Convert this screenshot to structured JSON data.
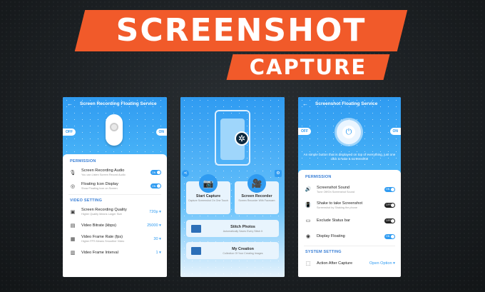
{
  "banner": {
    "line1": "SCREENSHOT",
    "line2": "CAPTURE"
  },
  "left_phone": {
    "title": "Screen Recording Floating Service",
    "off_label": "OFF",
    "on_label": "ON",
    "section_permission": "PERMISSION",
    "rows_permission": [
      {
        "label": "Screen Recording Audio",
        "sub": "You can Listen Screen Record Audio",
        "toggle": "ON"
      },
      {
        "label": "Floating Icon Display",
        "sub": "Show Floating Icon on Screen",
        "toggle": "ON"
      }
    ],
    "section_video": "VIDEO SETTING",
    "rows_video": [
      {
        "label": "Screen Recording Quality",
        "sub": "Higher Quality Means Larger Size",
        "value": "720p"
      },
      {
        "label": "Video Bitrate (kbps)",
        "sub": "",
        "value": "25000"
      },
      {
        "label": "Video Frame Rate (fps)",
        "sub": "Higher FPS Means Smoother Video",
        "value": "30"
      },
      {
        "label": "Video Frame Interval",
        "sub": "",
        "value": "1"
      }
    ]
  },
  "mid_phone": {
    "start_capture": {
      "label": "Start Capture",
      "sub": "Capture Screenshot On One Touch"
    },
    "screen_recorder": {
      "label": "Screen Recorder",
      "sub": "Screen Recorder With Facecam"
    },
    "stitch_photos": {
      "label": "Stitch Photos",
      "sub": "Automatically Saves Every Stitch It"
    },
    "my_creation": {
      "label": "My Creation",
      "sub": "Collection Of Your Creating Images"
    }
  },
  "right_phone": {
    "title": "Screenshot Floating Service",
    "off_label": "OFF",
    "on_label": "ON",
    "description": "An simple button that is displayed on top of everything, just one click to take a screenshot!",
    "section_permission": "PERMISSION",
    "rows": [
      {
        "label": "Screenshot Sound",
        "sub": "Tune Off/On Screenshot Sound",
        "toggle": "ON",
        "state": "on"
      },
      {
        "label": "Shake to take Screenshot",
        "sub": "Screenshot by Shaking the phone",
        "toggle": "OFF",
        "state": "off"
      },
      {
        "label": "Exclude Status bar",
        "sub": "",
        "toggle": "OFF",
        "state": "off"
      },
      {
        "label": "Display Floating",
        "sub": "",
        "toggle": "ON",
        "state": "on"
      }
    ],
    "section_system": "SYSTEM SETTING",
    "action_after": {
      "label": "Action After Capture",
      "value": "Open Option"
    }
  },
  "colors": {
    "accent": "#2f9bf1",
    "banner": "#f15a2a"
  }
}
